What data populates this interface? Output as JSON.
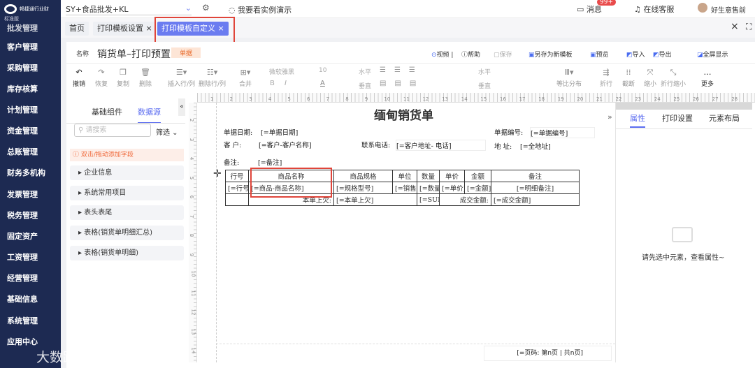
{
  "sidebar": {
    "brand": "畅捷通行业财",
    "edition": "标准版",
    "items": [
      "批发管理",
      "客户管理",
      "采购管理",
      "库存核算",
      "计划管理",
      "资金管理",
      "总账管理",
      "财务多机构",
      "发票管理",
      "税务管理",
      "固定资产",
      "工资管理",
      "经营管理",
      "基础信息",
      "系统管理",
      "应用中心"
    ]
  },
  "topbar": {
    "account": "SY+食品批发+KL",
    "demo": "我要看实例演示",
    "messages": "消息",
    "badge": "99+",
    "service": "在线客服",
    "user": "好生意售前"
  },
  "tabs": [
    {
      "label": "首页"
    },
    {
      "label": "打印模板设置"
    },
    {
      "label": "打印模板自定义"
    }
  ],
  "header": {
    "name_label": "名称",
    "name": "销货单–打印预置",
    "tag": "单据",
    "actions": [
      "视频",
      "帮助",
      "保存",
      "另存为新模板",
      "预览",
      "导入",
      "导出",
      "全屏显示"
    ]
  },
  "toolbar": {
    "undo": "撤销",
    "redo": "恢复",
    "copy": "复制",
    "delete": "删除",
    "insert": "插入行/列",
    "remove": "删除行/列",
    "merge": "合并",
    "font": "微软雅黑",
    "size": "10",
    "bold": "B",
    "italic": "I",
    "color": "A",
    "horiz": "水平",
    "vert": "垂直",
    "distribute": "等比分布",
    "wrap": "折行",
    "cut": "截断",
    "shrink": "缩小",
    "wrapshrink": "折行缩小",
    "more": "更多"
  },
  "left_panel": {
    "tabs": [
      "基础组件",
      "数据源"
    ],
    "search_placeholder": "请搜索",
    "filter": "筛选",
    "hint": "双击/拖动添加字段",
    "groups": [
      "企业信息",
      "系统常用项目",
      "表头表尾",
      "表格(销货单明细汇总)",
      "表格(销货单明细)"
    ]
  },
  "ruler": {
    "h": [
      "1",
      "2",
      "3",
      "4",
      "5",
      "6",
      "7",
      "8",
      "9",
      "10",
      "11",
      "12",
      "13",
      "14",
      "15",
      "16",
      "17",
      "18",
      "19",
      "20",
      "21",
      "22",
      "23",
      "24",
      "25",
      "26",
      "27",
      "28"
    ],
    "v": [
      "2",
      "3",
      "4",
      "5",
      "6",
      "7",
      "8",
      "9",
      "10",
      "11",
      "12",
      "13",
      "14"
    ]
  },
  "document": {
    "title": "缅甸销货单",
    "fields": {
      "date_label": "单据日期:",
      "date": "[=单据日期]",
      "no_label": "单据编号:",
      "no": "[=单据编号]",
      "cust_label": "客 户:",
      "cust": "[=客户-客户名称]",
      "phone_label": "联系电话:",
      "phone": "[=客户地址-  电话]",
      "addr_label": "地 址:",
      "addr": "[=全地址]",
      "note_label": "备注:",
      "note": "[=备注]"
    },
    "table": {
      "headers": [
        "行号",
        "商品名称",
        "商品规格",
        "单位",
        "数量",
        "单价",
        "金额",
        "备注"
      ],
      "row": [
        "[=行号",
        "[=商品-商品名称]",
        "[=规格型号]",
        "[=销售单",
        "[=数量",
        "[=单价]",
        "[=金额]",
        "[=明细备注]"
      ],
      "footer": {
        "prev_label": "本单上欠:",
        "prev": "[=本单上欠]",
        "sum": "[=SUM",
        "total_label": "成交金额:",
        "total": "[=成交金额]"
      }
    },
    "page_no": "[=页码: 第n页 | 共n页]"
  },
  "right_panel": {
    "tabs": [
      "属性",
      "打印设置",
      "元素布局"
    ],
    "empty": "请先选中元素，查看属性~"
  },
  "watermark": "大数跨境",
  "colors": {
    "sidebar": "#1d2a52",
    "accent": "#6b7cf0",
    "highlight": "#e0453a"
  }
}
